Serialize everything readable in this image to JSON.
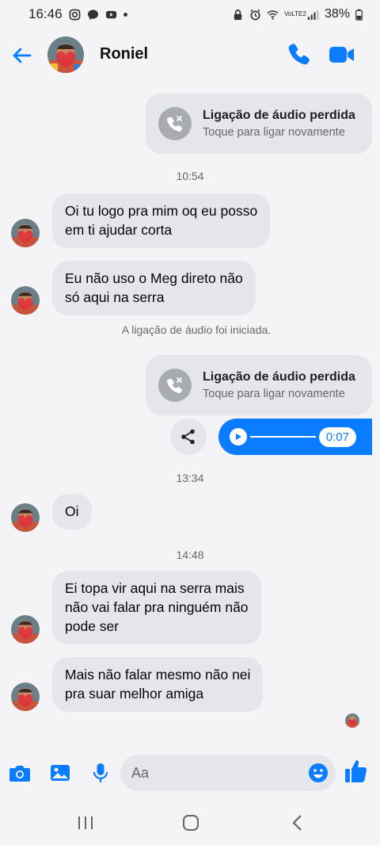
{
  "status_bar": {
    "time": "16:46",
    "signal_label": "VoLTE2",
    "battery": "38%"
  },
  "header": {
    "contact_name": "Roniel",
    "icons": {
      "back": "back-arrow-icon",
      "call": "phone-icon",
      "video": "video-camera-icon"
    }
  },
  "colors": {
    "accent": "#0a7cff",
    "bubble": "#e4e6eb",
    "background": "#f4f4f6"
  },
  "chat": {
    "missed_call_1": {
      "title": "Ligação de áudio perdida",
      "subtitle": "Toque para ligar novamente"
    },
    "timestamp_1": "10:54",
    "message_1": {
      "lines": [
        "Oi tu logo pra mim oq eu posso",
        "em ti ajudar corta"
      ]
    },
    "message_2": {
      "lines": [
        "Eu não uso o Meg direto não",
        "só aqui na serra"
      ]
    },
    "system_note": "A ligação de áudio foi iniciada.",
    "missed_call_2": {
      "title": "Ligação de áudio perdida",
      "subtitle": "Toque para ligar novamente"
    },
    "audio_message": {
      "duration": "0:07",
      "progress": 0
    },
    "timestamp_2": "13:34",
    "message_3": {
      "lines": [
        "Oi"
      ]
    },
    "timestamp_3": "14:48",
    "message_4": {
      "lines": [
        "Ei topa vir aqui na serra mais",
        "não vai falar pra ninguém não",
        "pode ser"
      ]
    },
    "message_5": {
      "lines": [
        "Mais não falar mesmo não nei",
        "pra suar melhor amiga"
      ]
    }
  },
  "composer": {
    "placeholder": "Aa",
    "icons": [
      "camera-icon",
      "image-icon",
      "microphone-icon",
      "emoji-icon",
      "thumbs-up-icon"
    ]
  }
}
